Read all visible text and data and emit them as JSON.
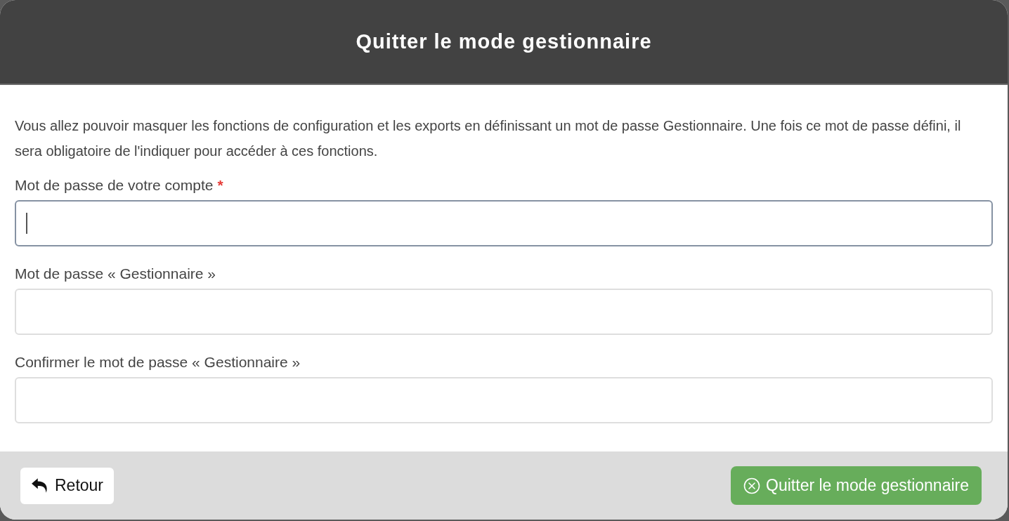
{
  "dialog": {
    "title": "Quitter le mode gestionnaire",
    "intro": "Vous allez pouvoir masquer les fonctions de configuration et les exports en définissant un mot de passe Gestionnaire. Une fois ce mot de passe défini, il sera obligatoire de l'indiquer pour accéder à ces fonctions.",
    "fields": [
      {
        "label": "Mot de passe de votre compte",
        "required_mark": "*",
        "focused": true
      },
      {
        "label": "Mot de passe « Gestionnaire »",
        "focused": false
      },
      {
        "label": "Confirmer le mot de passe « Gestionnaire »",
        "focused": false
      }
    ],
    "buttons": [
      {
        "kind": "back",
        "label": "Retour"
      },
      {
        "kind": "confirm",
        "label": "Quitter le mode gestionnaire"
      }
    ]
  }
}
